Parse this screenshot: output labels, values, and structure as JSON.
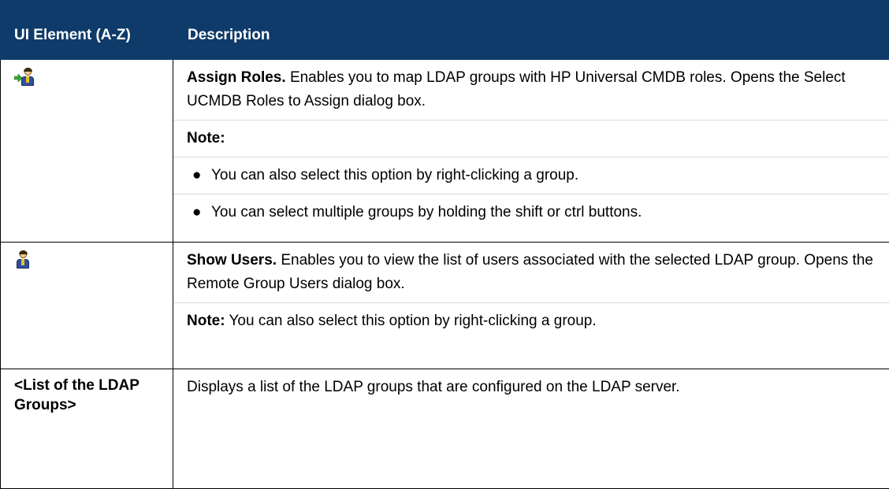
{
  "table": {
    "header": {
      "col1": "UI Element (A-Z)",
      "col2": "Description"
    },
    "rows": [
      {
        "element_icon": "assign-roles-icon",
        "title": "Assign Roles.",
        "text": "Enables you to map LDAP groups with HP Universal CMDB roles. Opens the Select UCMDB Roles to Assign dialog box.",
        "note_label": "Note:",
        "bullets": [
          "You can also select this option by right-clicking a group.",
          "You can select multiple groups by holding the shift or ctrl buttons."
        ]
      },
      {
        "element_icon": "show-users-icon",
        "title": "Show Users.",
        "text": "Enables you to view the list of users associated with the selected LDAP group. Opens the Remote Group Users dialog box.",
        "note_label": "Note:",
        "note_text": "You can also select this option by right-clicking a group."
      },
      {
        "element_label": "<List of the LDAP Groups>",
        "text": "Displays a list of the LDAP groups that are configured on the LDAP server."
      }
    ]
  },
  "colors": {
    "header_bg": "#0e3b6a",
    "header_text": "#ffffff",
    "border": "#000000",
    "divider": "#d9d9d9"
  }
}
